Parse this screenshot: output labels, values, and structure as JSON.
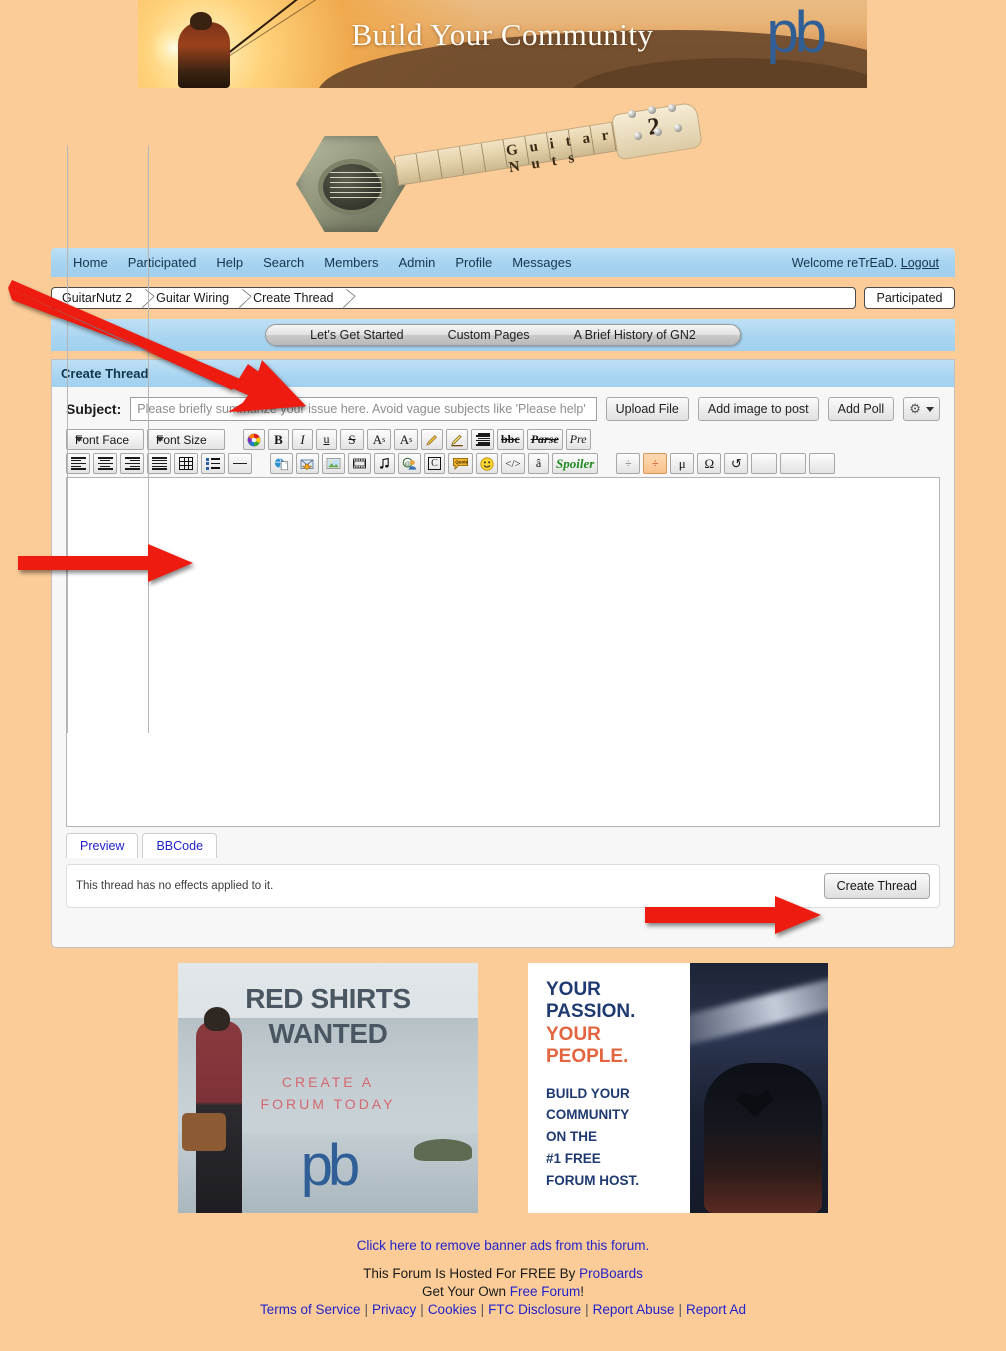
{
  "banner": {
    "title": "Build Your Community",
    "logo_text": "pb"
  },
  "site_logo": {
    "text": "Guitar Nuts",
    "number": "2"
  },
  "navbar": {
    "items": [
      {
        "label": "Home"
      },
      {
        "label": "Participated"
      },
      {
        "label": "Help"
      },
      {
        "label": "Search"
      },
      {
        "label": "Members"
      },
      {
        "label": "Admin"
      },
      {
        "label": "Profile"
      },
      {
        "label": "Messages"
      }
    ],
    "welcome": "Welcome reTrEaD.",
    "logout": "Logout"
  },
  "breadcrumb": {
    "items": [
      "GuitarNutz 2",
      "Guitar Wiring",
      "Create Thread"
    ],
    "participated_button": "Participated"
  },
  "tabstrip": {
    "items": [
      "Let's Get Started",
      "Custom Pages",
      "A Brief History of GN2"
    ]
  },
  "panel": {
    "title": "Create Thread",
    "subject_label": "Subject:",
    "subject_value": "",
    "subject_placeholder": "Please briefly summarize your issue here. Avoid vague subjects like 'Please help'",
    "buttons": {
      "upload_file": "Upload File",
      "add_image": "Add image to post",
      "add_poll": "Add Poll",
      "settings_icon": "gear-icon",
      "settings_caret": "chevron-down-icon"
    }
  },
  "toolbar": {
    "font_face": "Font Face",
    "font_size": "Font Size",
    "row1": [
      {
        "name": "text-color-icon",
        "glyph": ""
      },
      {
        "name": "bold-button",
        "glyph": "B"
      },
      {
        "name": "italic-button",
        "glyph": "I"
      },
      {
        "name": "underline-button",
        "glyph": "u"
      },
      {
        "name": "strikethrough-button",
        "glyph": "S"
      },
      {
        "name": "superscript-button",
        "glyph": "A"
      },
      {
        "name": "subscript-button",
        "glyph": "A"
      },
      {
        "name": "highlight-pencil-icon",
        "glyph": ""
      },
      {
        "name": "edit-pencil-icon",
        "glyph": ""
      },
      {
        "name": "justify-block-icon",
        "glyph": ""
      },
      {
        "name": "remove-bbcode-button",
        "glyph": "bbc"
      },
      {
        "name": "parse-button",
        "glyph": "Parse"
      },
      {
        "name": "preformatted-button",
        "glyph": "Pre"
      }
    ],
    "row2": [
      {
        "name": "align-left-icon"
      },
      {
        "name": "align-center-icon"
      },
      {
        "name": "align-right-icon"
      },
      {
        "name": "align-justify-icon"
      },
      {
        "name": "insert-table-icon"
      },
      {
        "name": "bullet-list-icon"
      },
      {
        "name": "horizontal-rule-icon"
      },
      {
        "name": "insert-link-icon"
      },
      {
        "name": "insert-email-icon"
      },
      {
        "name": "insert-image-icon"
      },
      {
        "name": "insert-video-icon"
      },
      {
        "name": "insert-audio-icon"
      },
      {
        "name": "mention-user-icon"
      },
      {
        "name": "copyright-button",
        "glyph": "C"
      },
      {
        "name": "quote-button",
        "glyph": "Quote"
      },
      {
        "name": "emoticon-icon"
      },
      {
        "name": "source-code-button",
        "glyph": "</>"
      },
      {
        "name": "special-character-button",
        "glyph": "â"
      },
      {
        "name": "spoiler-button",
        "glyph": "Spoiler"
      },
      {
        "name": "divider-button-off",
        "glyph": "÷"
      },
      {
        "name": "divider-button-on",
        "glyph": "÷"
      },
      {
        "name": "micro-symbol-button",
        "glyph": "μ"
      },
      {
        "name": "omega-symbol-button",
        "glyph": "Ω"
      },
      {
        "name": "refresh-button",
        "glyph": "↺"
      },
      {
        "name": "blank-button-1",
        "glyph": ""
      },
      {
        "name": "blank-button-2",
        "glyph": ""
      },
      {
        "name": "blank-button-3",
        "glyph": ""
      }
    ]
  },
  "editor": {
    "body_text": "",
    "tabs": [
      "Preview",
      "BBCode"
    ]
  },
  "effects": {
    "note": "This thread has no effects applied to it.",
    "submit_label": "Create Thread"
  },
  "ads": {
    "ad1": {
      "headline_line1": "RED SHIRTS",
      "headline_line2": "WANTED",
      "sub_line1": "CREATE A",
      "sub_line2": "FORUM TODAY",
      "logo": "pb"
    },
    "ad2": {
      "line1": "YOUR",
      "line2": "PASSION.",
      "line3": "YOUR",
      "line4": "PEOPLE.",
      "body_line1": "BUILD YOUR",
      "body_line2": "COMMUNITY",
      "body_line3": "ON THE",
      "body_line4": "#1 FREE",
      "body_line5": "FORUM HOST."
    }
  },
  "footer": {
    "remove_ads": "Click here to remove banner ads from this forum.",
    "hosted_prefix": "This Forum Is Hosted For FREE By ",
    "hosted_link": "ProBoards",
    "getown_prefix": "Get Your Own ",
    "getown_link": "Free Forum",
    "getown_suffix": "!",
    "links": [
      "Terms of Service",
      "Privacy",
      "Cookies",
      "FTC Disclosure",
      "Report Abuse",
      "Report Ad"
    ],
    "separator": "|"
  },
  "annotations": {
    "arrow_color": "#ee1c10",
    "arrows": [
      "subject-field-arrow",
      "editor-body-arrow",
      "create-thread-arrow"
    ]
  },
  "colors": {
    "page_background": "#fbcc98",
    "nav_blue": "#a9d5f1",
    "link_blue": "#2222cc",
    "accent_orange": "#e2653f",
    "brand_blue": "#2f5f96"
  }
}
